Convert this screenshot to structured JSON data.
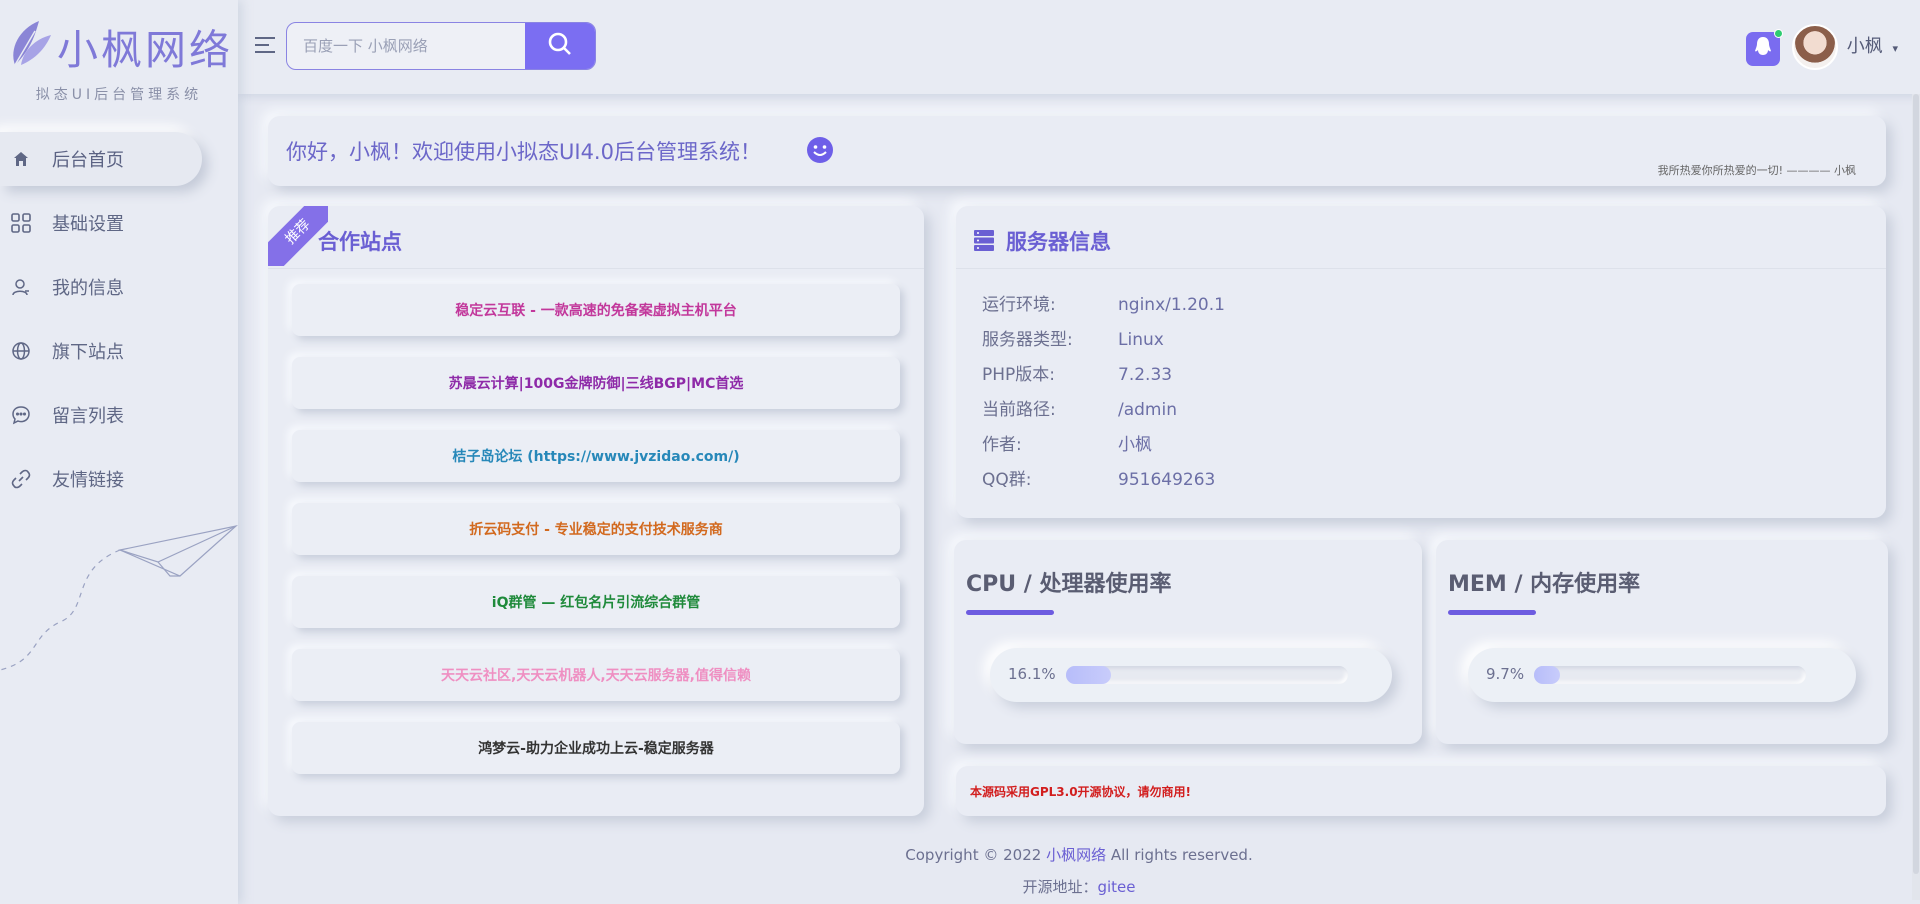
{
  "brand": {
    "title": "小枫网络",
    "subtitle": "拟态UI后台管理系统"
  },
  "sidebar": {
    "items": [
      {
        "label": "后台首页",
        "icon": "home-icon",
        "active": true
      },
      {
        "label": "基础设置",
        "icon": "grid-icon",
        "active": false
      },
      {
        "label": "我的信息",
        "icon": "user-icon",
        "active": false
      },
      {
        "label": "旗下站点",
        "icon": "globe-icon",
        "active": false
      },
      {
        "label": "留言列表",
        "icon": "chat-icon",
        "active": false
      },
      {
        "label": "友情链接",
        "icon": "link-icon",
        "active": false
      }
    ]
  },
  "header": {
    "search_placeholder": "百度一下 小枫网络",
    "username": "小枫"
  },
  "welcome": {
    "text": "你好，小枫！欢迎使用小拟态UI4.0后台管理系统！",
    "motto": "我所热爱你所热爱的一切! ———— 小枫"
  },
  "partners": {
    "ribbon": "推荐",
    "title": "合作站点",
    "links": [
      {
        "label": "稳定云互联 - 一款高速的免备案虚拟主机平台",
        "color": "#c2379b"
      },
      {
        "label": "苏晨云计算|100G金牌防御|三线BGP|MC首选",
        "color": "#8e2aa8"
      },
      {
        "label": "桔子岛论坛 (https://www.jvzidao.com/)",
        "color": "#2788b9"
      },
      {
        "label": "折云码支付 - 专业稳定的支付技术服务商",
        "color": "#d2691e"
      },
      {
        "label": "iQ群管 — 红包名片引流综合群管",
        "color": "#1f8a3b"
      },
      {
        "label": "天天云社区,天天云机器人,天天云服务器,值得信赖",
        "color": "#ef8fc2"
      },
      {
        "label": "鸿梦云-助力企业成功上云-稳定服务器",
        "color": "#333333"
      }
    ]
  },
  "server": {
    "title": "服务器信息",
    "rows": [
      {
        "key": "运行环境:",
        "value": "nginx/1.20.1"
      },
      {
        "key": "服务器类型:",
        "value": "Linux"
      },
      {
        "key": "PHP版本:",
        "value": "7.2.33"
      },
      {
        "key": "当前路径:",
        "value": "/admin"
      },
      {
        "key": "作者:",
        "value": "小枫"
      },
      {
        "key": "QQ群:",
        "value": "951649263"
      }
    ]
  },
  "cpu": {
    "title": "CPU / 处理器使用率",
    "label": "16.1%",
    "percent": 16.1
  },
  "mem": {
    "title": "MEM / 内存使用率",
    "label": "9.7%",
    "percent": 9.7
  },
  "notice": {
    "text": "本源码采用GPL3.0开源协议，请勿商用!"
  },
  "footer": {
    "copyright_prefix": "Copyright © 2022 ",
    "copyright_link": "小枫网络",
    "copyright_suffix": " All rights reserved.",
    "source_label": "开源地址：",
    "source_link": "gitee"
  },
  "colors": {
    "accent": "#7b6ef2",
    "background": "#e6e9f2",
    "notice": "#d21e1e"
  }
}
